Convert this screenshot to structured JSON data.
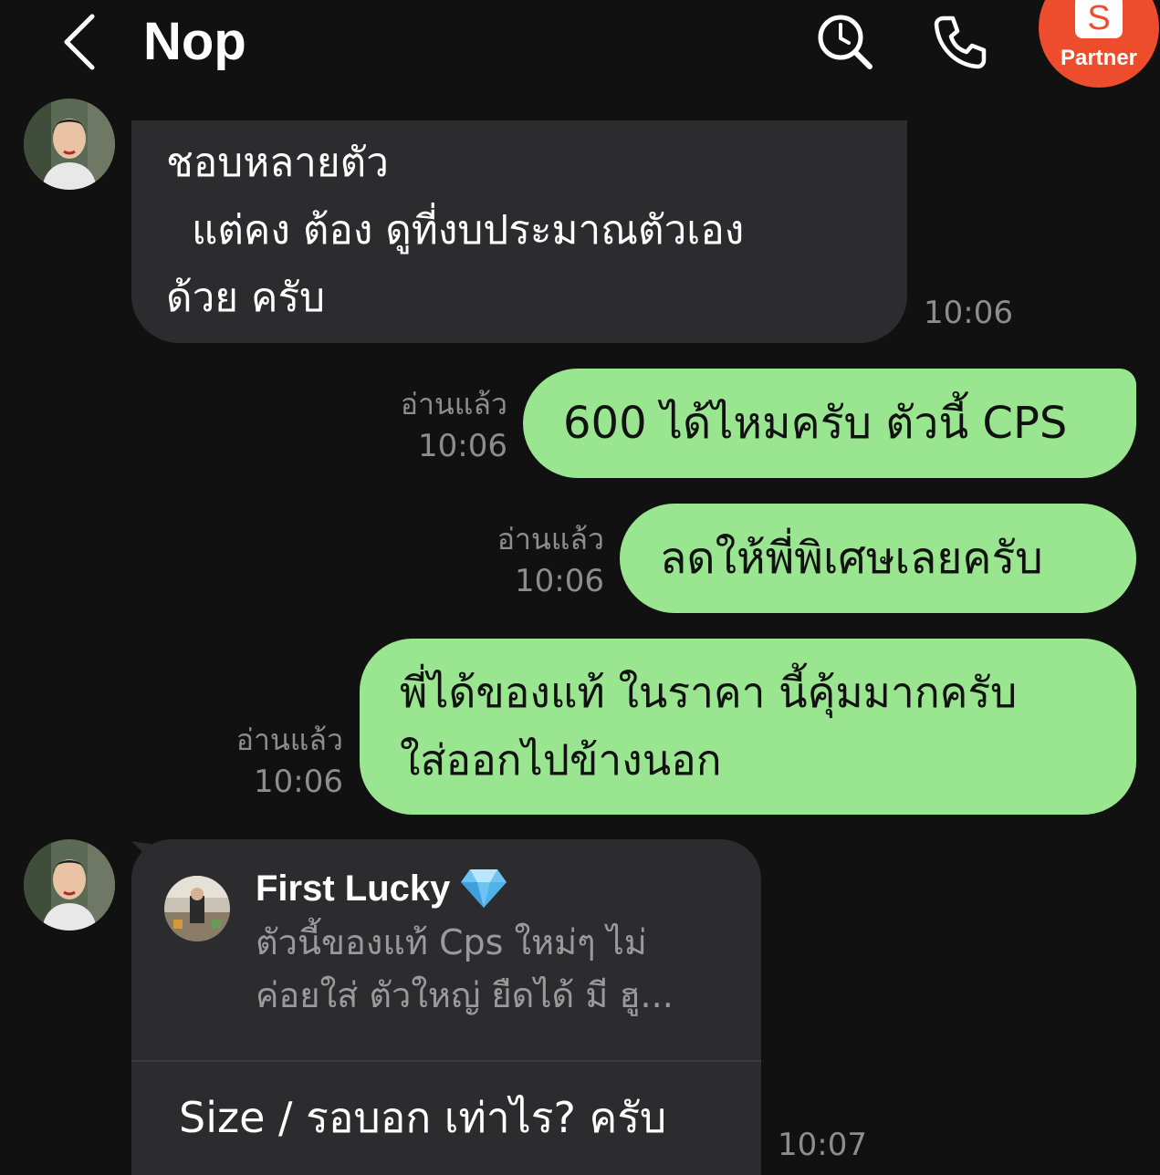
{
  "header": {
    "title": "Nop",
    "back_icon": "chevron-left-icon",
    "search_icon": "search-icon",
    "call_icon": "phone-icon",
    "partner": {
      "badge_letter": "S",
      "label": "Partner",
      "color": "#ee4d2d"
    }
  },
  "colors": {
    "background": "#111111",
    "incoming_bubble": "#2c2c2e",
    "outgoing_bubble": "#9ae58f",
    "meta_text": "#8d8d8d"
  },
  "messages": [
    {
      "direction": "incoming",
      "text": "ชอบหลายตัว\n  แต่คง ต้อง ดูที่งบประมาณตัวเอง\nด้วย ครับ",
      "time": "10:06"
    },
    {
      "direction": "outgoing",
      "text": "600 ได้ไหมครับ ตัวนี้ CPS",
      "read": "อ่านแล้ว",
      "time": "10:06"
    },
    {
      "direction": "outgoing",
      "text": "ลดให้พี่พิเศษเลยครับ",
      "read": "อ่านแล้ว",
      "time": "10:06"
    },
    {
      "direction": "outgoing",
      "text": "พี่ได้ของแท้ ในราคา นี้คุ้มมากครับ\nใส่ออกไปข้างนอก",
      "read": "อ่านแล้ว",
      "time": "10:06"
    },
    {
      "direction": "incoming",
      "reply_to": {
        "name": "First Lucky",
        "badge_icon": "diamond-icon",
        "preview": "ตัวนี้ของแท้ Cps ใหม่ๆ ไม่\nค่อยใส่ ตัวใหญ่ ยืดได้ มี ฮู..."
      },
      "text": "Size / รอบอก เท่าไร? ครับ",
      "time": "10:07"
    }
  ]
}
